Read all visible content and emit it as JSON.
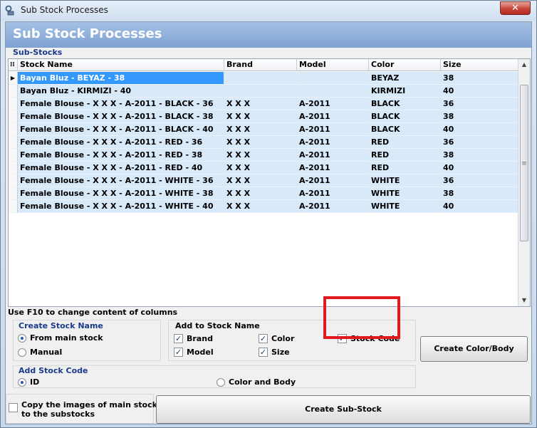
{
  "window": {
    "title": "Sub Stock Processes",
    "close_glyph": "✕"
  },
  "header": {
    "title": "Sub Stock Processes"
  },
  "grid": {
    "label": "Sub-Stocks",
    "columns": [
      "Stock Name",
      "Brand",
      "Model",
      "Color",
      "Size"
    ],
    "rows": [
      {
        "name": "Bayan Bluz - BEYAZ - 38",
        "brand": "",
        "model": "",
        "color": "BEYAZ",
        "size": "38",
        "selected": true
      },
      {
        "name": "Bayan Bluz - KIRMIZI - 40",
        "brand": "",
        "model": "",
        "color": "KIRMIZI",
        "size": "40"
      },
      {
        "name": "Female Blouse - X X X - A-2011 - BLACK - 36",
        "brand": "X X X",
        "model": "A-2011",
        "color": "BLACK",
        "size": "36"
      },
      {
        "name": "Female Blouse - X X X - A-2011 - BLACK - 38",
        "brand": "X X X",
        "model": "A-2011",
        "color": "BLACK",
        "size": "38"
      },
      {
        "name": "Female Blouse - X X X - A-2011 - BLACK - 40",
        "brand": "X X X",
        "model": "A-2011",
        "color": "BLACK",
        "size": "40"
      },
      {
        "name": "Female Blouse - X X X - A-2011 - RED - 36",
        "brand": "X X X",
        "model": "A-2011",
        "color": "RED",
        "size": "36"
      },
      {
        "name": "Female Blouse - X X X - A-2011 - RED - 38",
        "brand": "X X X",
        "model": "A-2011",
        "color": "RED",
        "size": "38"
      },
      {
        "name": "Female Blouse - X X X - A-2011 - RED - 40",
        "brand": "X X X",
        "model": "A-2011",
        "color": "RED",
        "size": "40"
      },
      {
        "name": "Female Blouse - X X X - A-2011 - WHITE - 36",
        "brand": "X X X",
        "model": "A-2011",
        "color": "WHITE",
        "size": "36"
      },
      {
        "name": "Female Blouse - X X X - A-2011 - WHITE - 38",
        "brand": "X X X",
        "model": "A-2011",
        "color": "WHITE",
        "size": "38"
      },
      {
        "name": "Female Blouse - X X X - A-2011 - WHITE - 40",
        "brand": "X X X",
        "model": "A-2011",
        "color": "WHITE",
        "size": "40"
      }
    ]
  },
  "hint": "Use F10 to change content of columns",
  "create_stock_name": {
    "title": "Create Stock Name",
    "options": [
      {
        "label": "From main stock",
        "selected": true
      },
      {
        "label": "Manual",
        "selected": false
      }
    ]
  },
  "add_to_stock_name": {
    "title": "Add to Stock Name",
    "brand": {
      "label": "Brand",
      "checked": true
    },
    "model": {
      "label": "Model",
      "checked": true
    },
    "color": {
      "label": "Color",
      "checked": true
    },
    "size": {
      "label": "Size",
      "checked": true
    },
    "stock_code": {
      "label": "Stock Code",
      "checked": true
    }
  },
  "add_stock_code": {
    "title": "Add Stock Code",
    "options": [
      {
        "label": "ID",
        "selected": true
      },
      {
        "label": "Color and Body",
        "selected": false
      }
    ]
  },
  "buttons": {
    "create_color_body": "Create Color/Body",
    "create_sub_stock": "Create Sub-Stock"
  },
  "copy_images": {
    "label_line1": "Copy the images of main stocks",
    "label_line2": "to the substocks",
    "checked": false
  },
  "colors": {
    "accent_header": "#7ea2d2",
    "row_bg": "#d8e9fa",
    "selection": "#3399ff",
    "highlight_border": "#e0191e"
  }
}
